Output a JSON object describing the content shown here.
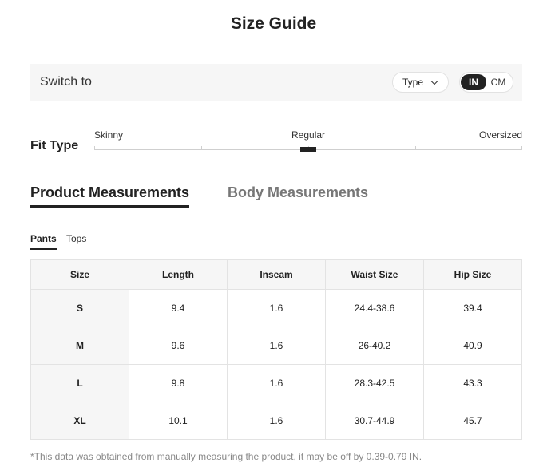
{
  "title": "Size Guide",
  "switch_bar": {
    "label": "Switch to",
    "type_select": "Type",
    "units": {
      "in": "IN",
      "cm": "CM",
      "selected": "IN"
    }
  },
  "fit_type": {
    "label": "Fit Type",
    "options": [
      "Skinny",
      "Regular",
      "Oversized"
    ],
    "selected": "Regular"
  },
  "tabs": [
    {
      "label": "Product Measurements",
      "active": true
    },
    {
      "label": "Body Measurements",
      "active": false
    }
  ],
  "subtabs": [
    {
      "label": "Pants",
      "active": true
    },
    {
      "label": "Tops",
      "active": false
    }
  ],
  "table": {
    "headers": [
      "Size",
      "Length",
      "Inseam",
      "Waist Size",
      "Hip Size"
    ],
    "rows": [
      [
        "S",
        "9.4",
        "1.6",
        "24.4-38.6",
        "39.4"
      ],
      [
        "M",
        "9.6",
        "1.6",
        "26-40.2",
        "40.9"
      ],
      [
        "L",
        "9.8",
        "1.6",
        "28.3-42.5",
        "43.3"
      ],
      [
        "XL",
        "10.1",
        "1.6",
        "30.7-44.9",
        "45.7"
      ]
    ]
  },
  "footnote": "*This data was obtained from manually measuring the product, it may be off by 0.39-0.79 IN.",
  "colors": {
    "accent": "#222222",
    "muted_tab": "#777777",
    "panel_bg": "#f6f6f6"
  }
}
